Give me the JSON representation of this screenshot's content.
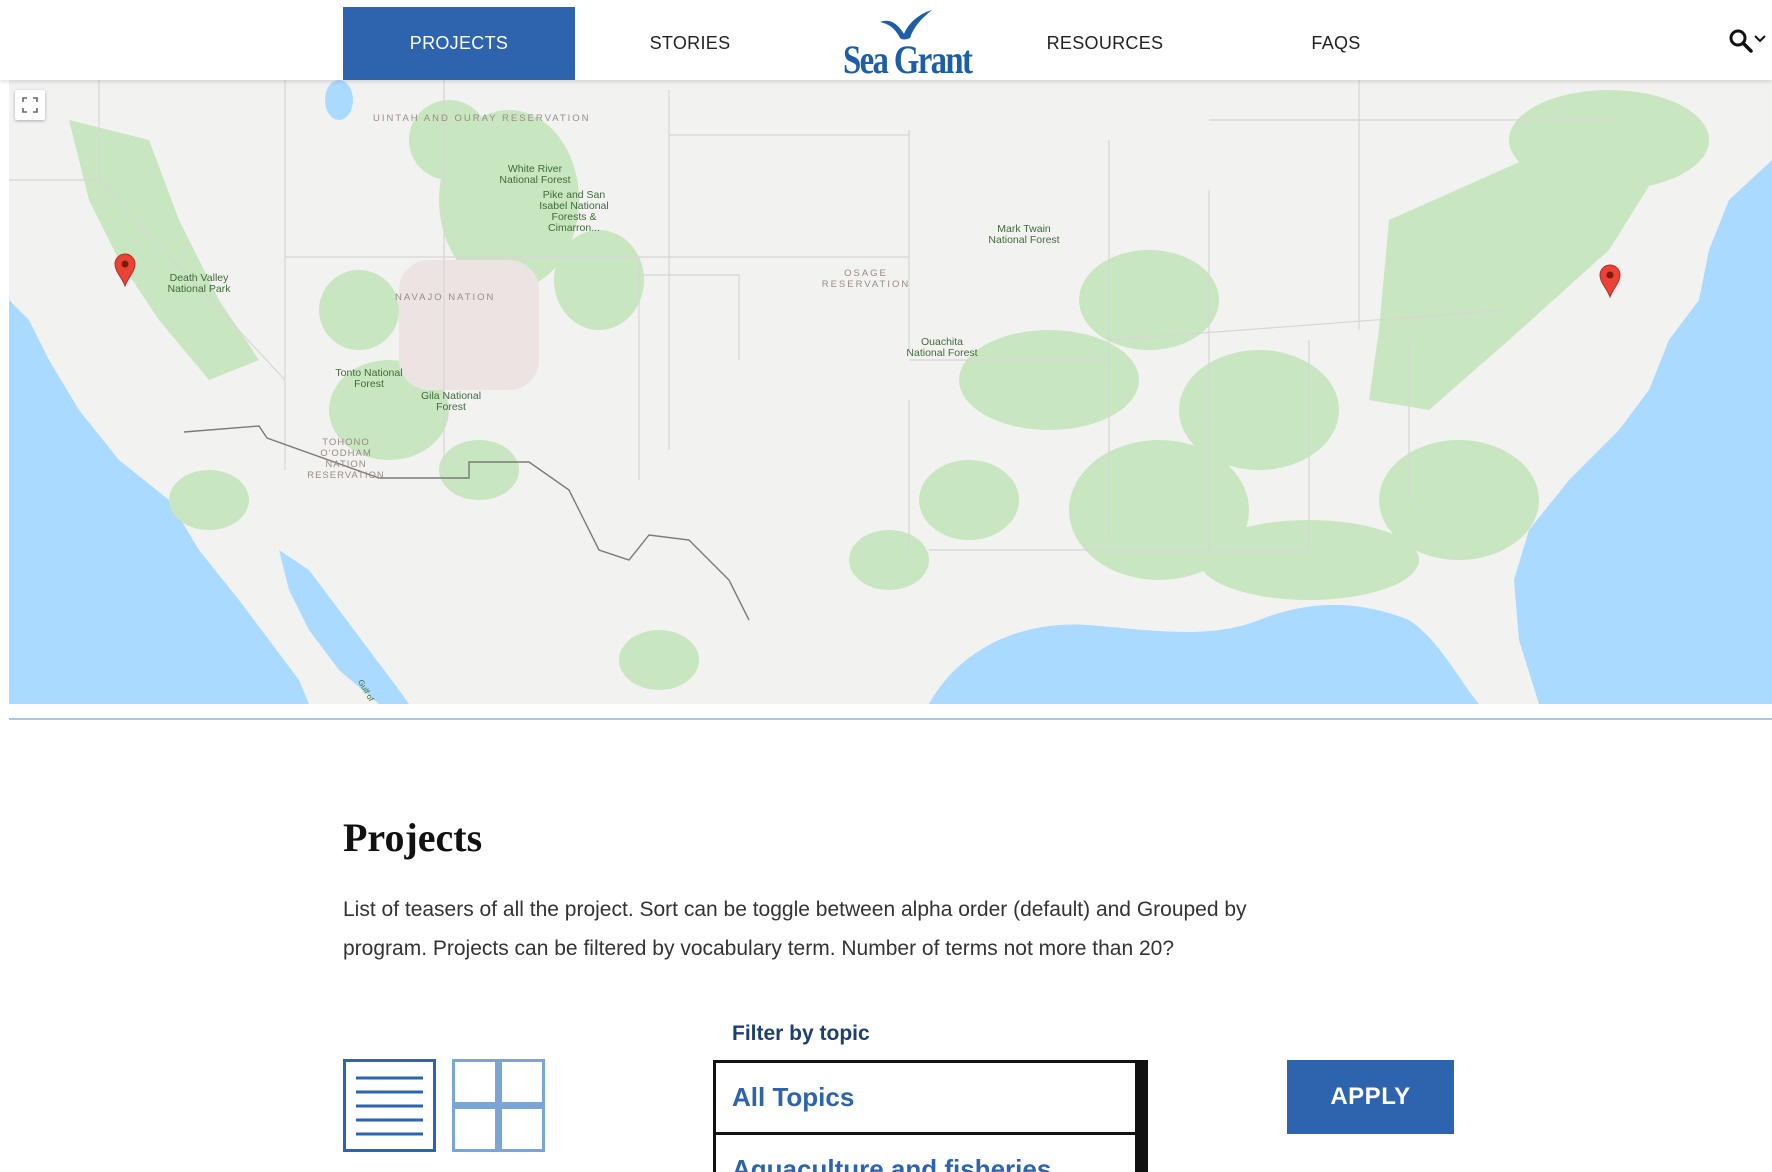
{
  "nav": {
    "projects": "PROJECTS",
    "stories": "STORIES",
    "logo": "Sea Grant",
    "resources": "RESOURCES",
    "faqs": "FAQS"
  },
  "colors": {
    "accent": "#2e63ad",
    "water": "#aadaff",
    "land": "#f2f2f0",
    "forest": "#c8e6c0",
    "marker": "#ea4335"
  },
  "map": {
    "labels": {
      "uintah": "UINTAH AND OURAY RESERVATION",
      "white_river": "White River National Forest",
      "pike": "Pike and San Isabel National Forests & Cimarron...",
      "death_valley": "Death Valley National Park",
      "navajo": "NAVAJO NATION",
      "osage": "OSAGE RESERVATION",
      "mark_twain": "Mark Twain National Forest",
      "ouachita": "Ouachita National Forest",
      "tonto": "Tonto National Forest",
      "gila": "Gila National Forest",
      "tohono": "TOHONO O'ODHAM NATION RESERVATION",
      "gulf_ca": "Gulf of"
    }
  },
  "main": {
    "title": "Projects",
    "intro": "List of teasers of all the project. Sort can be toggle between alpha order (default) and Grouped by program. Projects can be filtered by vocabulary term. Number of terms not more than 20?",
    "filter_label": "Filter by topic",
    "options": [
      "All Topics",
      "Aquaculture and fisheries"
    ],
    "apply": "APPLY"
  }
}
